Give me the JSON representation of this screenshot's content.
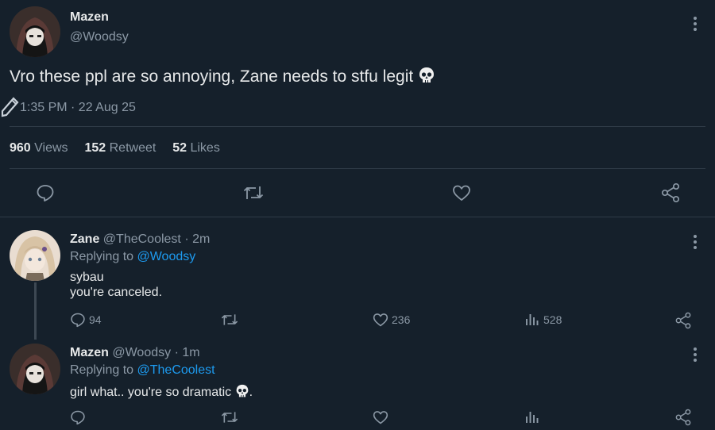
{
  "main_post": {
    "display_name": "Mazen",
    "handle": "@Woodsy",
    "text": "Vro these ppl are so annoying, Zane needs to stfu legit",
    "timestamp": "1:35 PM · 22 Aug 25",
    "stats": {
      "views_count": "960",
      "views_label": "Views",
      "retweets_count": "152",
      "retweets_label": "Retweet",
      "likes_count": "52",
      "likes_label": "Likes"
    }
  },
  "replies": [
    {
      "display_name": "Zane",
      "handle": "@TheCoolest",
      "time": "· 2m",
      "replying_prefix": "Replying to",
      "replying_handle": "@Woodsy",
      "line1": "sybau",
      "line2": "you're canceled.",
      "reply_count": "94",
      "like_count": "236",
      "view_count": "528"
    },
    {
      "display_name": "Mazen",
      "handle": "@Woodsy",
      "time": "· 1m",
      "replying_prefix": "Replying to",
      "replying_handle": "@TheCoolest",
      "line1": "girl what.. you're so dramatic",
      "line1_suffix": "."
    }
  ],
  "colors": {
    "background": "#15202b",
    "text": "#e7e9ea",
    "muted": "#8b98a5",
    "link": "#1d9bf0",
    "divider": "#2f3b47"
  }
}
